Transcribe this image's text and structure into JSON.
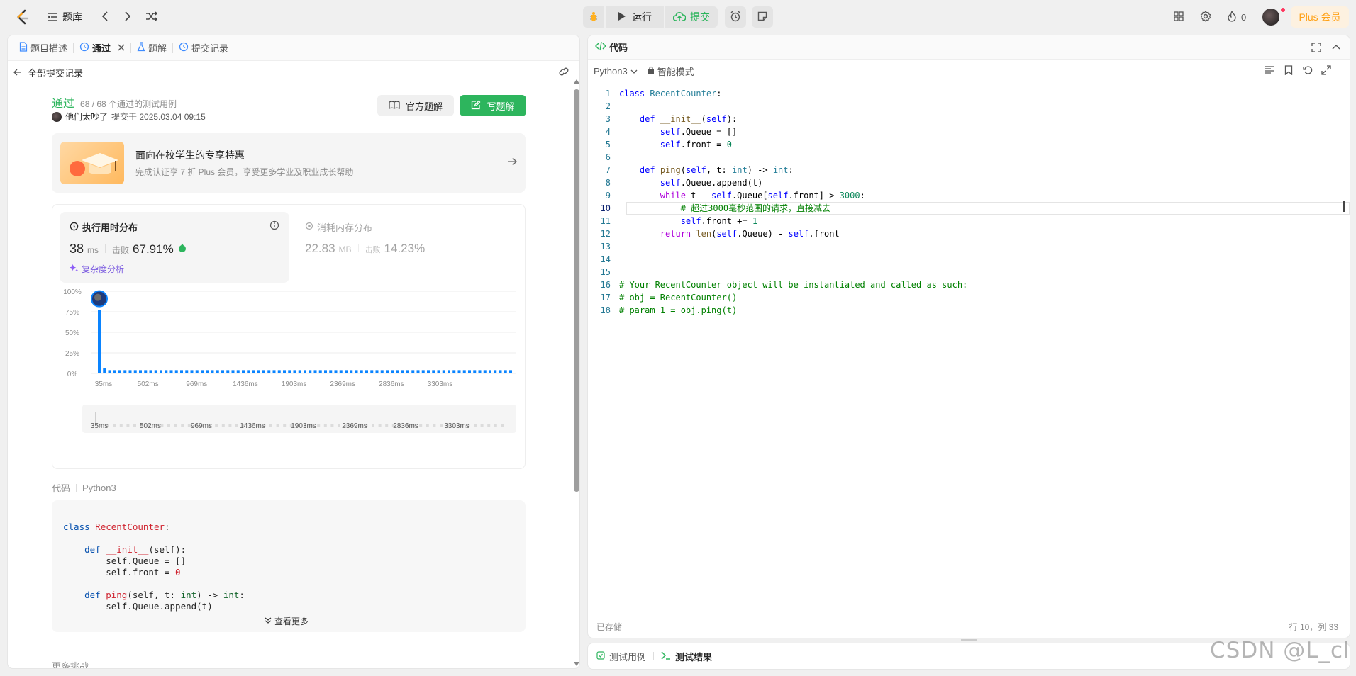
{
  "topbar": {
    "problem_bank": "题库",
    "run": "运行",
    "submit": "提交",
    "streak": "0",
    "plus": "Plus 会员"
  },
  "left": {
    "tabs": [
      {
        "label": "题目描述",
        "icon": "doc-icon"
      },
      {
        "label": "通过",
        "icon": "history-icon"
      },
      {
        "label": "题解",
        "icon": "flask-icon"
      },
      {
        "label": "提交记录",
        "icon": "history-icon"
      }
    ],
    "back_label": "全部提交记录",
    "status": "通过",
    "testcases": "68 / 68 个通过的测试用例",
    "user": "他们太吵了",
    "submitted_at": "提交于 2025.03.04 09:15",
    "official_solution": "官方题解",
    "write_solution": "写题解",
    "promo": {
      "title": "面向在校学生的专享特惠",
      "subtitle": "完成认证享 7 折 Plus 会员，享受更多学业及职业成长帮助"
    },
    "runtime": {
      "label": "执行用时分布",
      "value": "38",
      "unit": "ms",
      "beat_label": "击败",
      "beat": "67.91%",
      "analysis": "复杂度分析"
    },
    "memory": {
      "label": "消耗内存分布",
      "value": "22.83",
      "unit": "MB",
      "beat_label": "击败",
      "beat": "14.23%"
    },
    "code_label": "代码",
    "code_lang": "Python3",
    "see_more": "查看更多",
    "more_challenges": "更多挑战"
  },
  "chart_data": {
    "type": "bar",
    "x_ticks": [
      "35ms",
      "502ms",
      "969ms",
      "1436ms",
      "1903ms",
      "2369ms",
      "2836ms",
      "3303ms"
    ],
    "y_ticks": [
      "100%",
      "75%",
      "50%",
      "25%",
      "0%"
    ],
    "ylim": [
      0,
      100
    ],
    "values": [
      77,
      6,
      4,
      4,
      4,
      4,
      4,
      4,
      4,
      4,
      4,
      4,
      4,
      4,
      4,
      4,
      4,
      4,
      4,
      4,
      4,
      4,
      4,
      4,
      4,
      4,
      4,
      4,
      4,
      4,
      4,
      4,
      4,
      4,
      4,
      4,
      4,
      4,
      4,
      4,
      4,
      4,
      4,
      4,
      4,
      4,
      4,
      4,
      4,
      4,
      4,
      4,
      4,
      4,
      4,
      4,
      4,
      4,
      4,
      4,
      4,
      4,
      4,
      4,
      4,
      4,
      4,
      4,
      4,
      4,
      4,
      4,
      4,
      4,
      4,
      4,
      4,
      4,
      4,
      4,
      4
    ],
    "bar_color": "#0a84ff"
  },
  "right": {
    "header": "代码",
    "language": "Python3",
    "mode": "智能模式",
    "saved": "已存储",
    "cursor": "行 10，列 33",
    "bottom_tabs": [
      "测试用例",
      "测试结果"
    ],
    "watermark": "CSDN @L_cl"
  }
}
